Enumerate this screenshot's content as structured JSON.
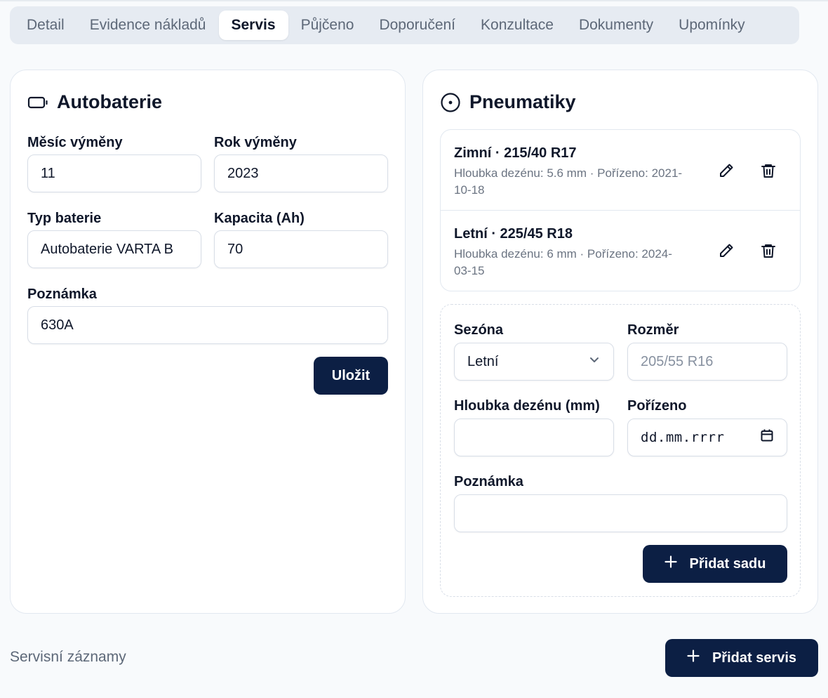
{
  "tabs": [
    {
      "label": "Detail",
      "active": false
    },
    {
      "label": "Evidence nákladů",
      "active": false
    },
    {
      "label": "Servis",
      "active": true
    },
    {
      "label": "Půjčeno",
      "active": false
    },
    {
      "label": "Doporučení",
      "active": false
    },
    {
      "label": "Konzultace",
      "active": false
    },
    {
      "label": "Dokumenty",
      "active": false
    },
    {
      "label": "Upomínky",
      "active": false
    }
  ],
  "battery": {
    "title": "Autobaterie",
    "icon": "battery-icon",
    "month_label": "Měsíc výměny",
    "month_value": "11",
    "year_label": "Rok výměny",
    "year_value": "2023",
    "type_label": "Typ baterie",
    "type_value": "Autobaterie VARTA B",
    "capacity_label": "Kapacita (Ah)",
    "capacity_value": "70",
    "note_label": "Poznámka",
    "note_value": "630A",
    "save_label": "Uložit"
  },
  "tires": {
    "title": "Pneumatiky",
    "icon": "tire-icon",
    "items": [
      {
        "title": "Zimní · 215/40 R17",
        "meta": "Hloubka dezénu: 5.6 mm · Pořízeno: 2021-10-18"
      },
      {
        "title": "Letní · 225/45 R18",
        "meta": "Hloubka dezénu: 6 mm · Pořízeno: 2024-03-15"
      }
    ],
    "form": {
      "season_label": "Sezóna",
      "season_value": "Letní",
      "size_label": "Rozměr",
      "size_placeholder": "205/55 R16",
      "depth_label": "Hloubka dezénu (mm)",
      "depth_value": "",
      "purchased_label": "Pořízeno",
      "purchased_placeholder": "dd.mm.rrrr",
      "note_label": "Poznámka",
      "note_value": "",
      "add_label": "Přidat sadu"
    }
  },
  "service": {
    "section_label": "Servisní záznamy",
    "add_label": "Přidat servis"
  },
  "colors": {
    "primary_button": "#0c1f44",
    "page_background": "#f8fafc",
    "tab_bar": "#e6ebf2"
  }
}
